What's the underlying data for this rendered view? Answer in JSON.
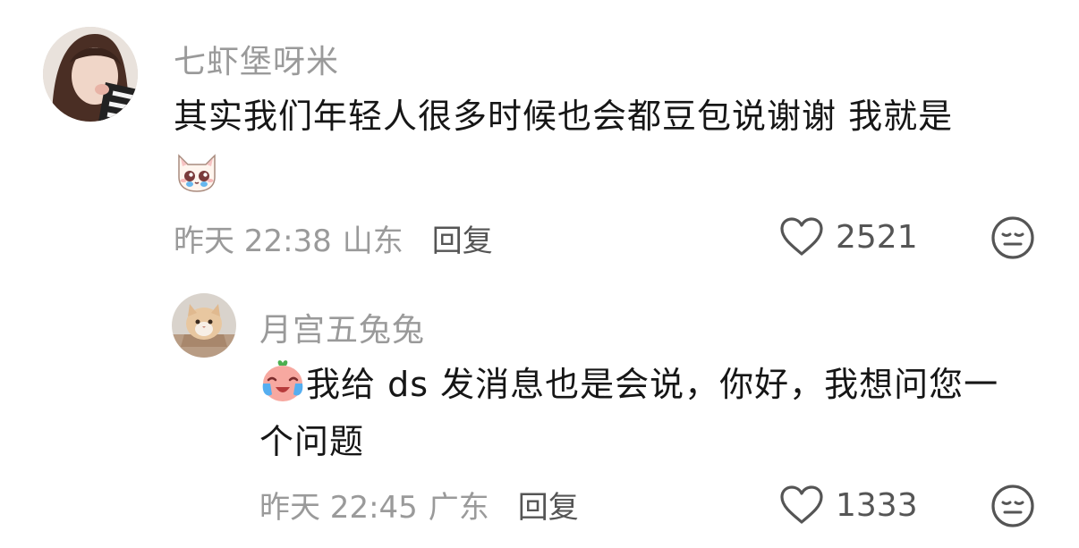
{
  "comments": [
    {
      "username": "七虾堡呀米",
      "text_line1": "其实我们年轻人很多时候也会都豆包说谢谢 我就是",
      "emoji": "crying-cat-emoji",
      "time": "昨天 22:38",
      "location": "山东",
      "reply_label": "回复",
      "likes": "2521",
      "avatar_icon": "user-avatar-photo"
    },
    {
      "username": "月宫五兔兔",
      "emoji": "crying-peach-emoji",
      "text_line1": "我给 ds 发消息也是会说，你好，我想问您一",
      "text_line2": "个问题",
      "time": "昨天 22:45",
      "location": "广东",
      "reply_label": "回复",
      "likes": "1333",
      "avatar_icon": "cat-avatar-photo"
    }
  ],
  "colors": {
    "secondary_text": "#9a9a9a",
    "primary_text": "#161616",
    "icon": "#555555"
  }
}
